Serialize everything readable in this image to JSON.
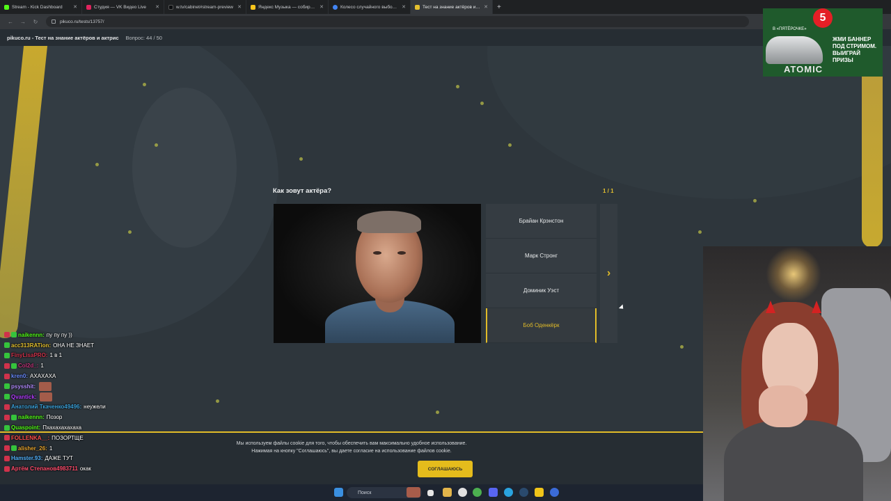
{
  "browser": {
    "tabs": [
      {
        "label": "Stream - Kick Dashboard",
        "color": "#53fc18"
      },
      {
        "label": "Студия — VK Видео Live",
        "color": "#e0245e"
      },
      {
        "label": "w.tv/cabinet#stream-preview",
        "color": "#1b1e21"
      },
      {
        "label": "Яндекс Музыка — собираем ...",
        "color": "#f8c51c"
      },
      {
        "label": "Колесо случайного выбора ...",
        "color": "#4285f4"
      },
      {
        "label": "Тест на знание актёров и актр...",
        "color": "#e4c02e",
        "active": true
      }
    ],
    "new_tab": "+",
    "url": "pikuco.ru/tests/13757/"
  },
  "page_header": {
    "site_title": "pikuco.ru - Тест на знание актёров и актрис",
    "question_counter": "Вопрос: 44 / 50"
  },
  "quiz": {
    "question": "Как зовут актёра?",
    "page_indicator": "1 / 1",
    "options": [
      {
        "label": "Брайан Крэнстон",
        "selected": false
      },
      {
        "label": "Марк Стронг",
        "selected": false
      },
      {
        "label": "Доминик Уэст",
        "selected": false
      },
      {
        "label": "Боб Оденкёрк",
        "selected": true
      }
    ],
    "next_icon": "›",
    "accent_color": "#e2bc28"
  },
  "cookie": {
    "line1": "Мы используем файлы cookie для того, чтобы обеспечить вам максимально удобное использование.",
    "line2": "Нажимая на кнопку \"Соглашаюсь\", вы даете согласие на использование файлов cookie.",
    "button": "СОГЛАШАЮСЬ"
  },
  "taskbar": {
    "search_placeholder": "Поиск"
  },
  "chat": [
    {
      "badges": [
        "live",
        "k"
      ],
      "user": "naikennn:",
      "color": "#53fc18",
      "text": "пу пу пу ))"
    },
    {
      "badges": [
        "k"
      ],
      "user": "acc313RATion:",
      "color": "#e4c02e",
      "text": "ОНА НЕ ЗНАЕТ"
    },
    {
      "badges": [
        "k"
      ],
      "user": "FinyLisaPRO:",
      "color": "#d0324b",
      "text": "1 в 1"
    },
    {
      "badges": [
        "live",
        "k"
      ],
      "user": "Col2d_:",
      "color": "#c0357a",
      "text": "1"
    },
    {
      "badges": [
        "live"
      ],
      "user": "kren0:",
      "color": "#6a8cff",
      "text": "АХАХАХА"
    },
    {
      "badges": [
        "k"
      ],
      "user": "psysshit:",
      "color": "#b38cff",
      "text": "",
      "emote": true
    },
    {
      "badges": [
        "k"
      ],
      "user": "Qvantick:",
      "color": "#b33cff",
      "text": "",
      "emote": true
    },
    {
      "badges": [
        "live"
      ],
      "user": "Анатолий Ткаченко49496:",
      "color": "#3aa0d8",
      "text": "неужели"
    },
    {
      "badges": [
        "live",
        "k"
      ],
      "user": "naikennn:",
      "color": "#53fc18",
      "text": "Позор"
    },
    {
      "badges": [
        "k"
      ],
      "user": "Quaspoint:",
      "color": "#53fc18",
      "text": "Пхахахахахаха"
    },
    {
      "badges": [
        "live"
      ],
      "user": "FOLLENKA__:",
      "color": "#ff4d4d",
      "text": "ПОЗОРТЩЕ"
    },
    {
      "badges": [
        "live",
        "k"
      ],
      "user": "alisher_26:",
      "color": "#e4a32e",
      "text": "1"
    },
    {
      "badges": [
        "live"
      ],
      "user": "Hamster.93:",
      "color": "#53b4ff",
      "text": "ДАЖЕ ТУТ"
    },
    {
      "badges": [
        "live"
      ],
      "user": "Артём Степанов4983711",
      "color": "#ff4d6d",
      "text": "окак"
    }
  ],
  "ad": {
    "badge": "5",
    "brand": "В «ПЯТЁРОЧКЕ»",
    "text": "ЖМИ БАННЕР ПОД СТРИМОМ. ВЫИГРАЙ ПРИЗЫ",
    "sub": "ATOMIC"
  }
}
